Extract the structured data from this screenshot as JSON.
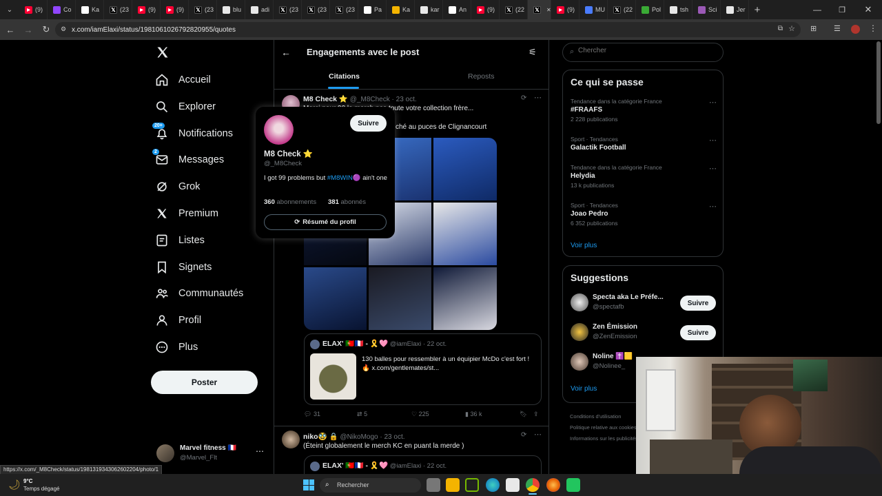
{
  "browser": {
    "tabs": [
      {
        "label": "(9)",
        "color": "#ff0033",
        "icon": "youtube-icon"
      },
      {
        "label": "Co",
        "color": "#9146ff",
        "icon": "twitch-icon"
      },
      {
        "label": "Ka",
        "color": "#ffffff",
        "icon": "kick-icon"
      },
      {
        "label": "(23",
        "color": "#000000",
        "icon": "x-icon"
      },
      {
        "label": "(9)",
        "color": "#ff0033",
        "icon": "youtube-icon"
      },
      {
        "label": "(9)",
        "color": "#ff0033",
        "icon": "youtube-icon"
      },
      {
        "label": "(23",
        "color": "#000000",
        "icon": "x-icon"
      },
      {
        "label": "blu",
        "color": "#e8e8e8",
        "icon": "globe-icon"
      },
      {
        "label": "adi",
        "color": "#e8e8e8",
        "icon": "globe-icon"
      },
      {
        "label": "(23",
        "color": "#000000",
        "icon": "x-icon"
      },
      {
        "label": "(23",
        "color": "#000000",
        "icon": "x-icon"
      },
      {
        "label": "(23",
        "color": "#000000",
        "icon": "x-icon"
      },
      {
        "label": "Pa",
        "color": "#ffffff",
        "icon": "page-icon"
      },
      {
        "label": "Ka",
        "color": "#f4b400",
        "icon": "folder-icon"
      },
      {
        "label": "kar",
        "color": "#e8e8e8",
        "icon": "globe-icon"
      },
      {
        "label": "An",
        "color": "#ffffff",
        "icon": "wikipedia-icon"
      },
      {
        "label": "(9)",
        "color": "#ff0033",
        "icon": "youtube-icon"
      },
      {
        "label": "(22",
        "color": "#000000",
        "icon": "x-icon"
      },
      {
        "label": "",
        "color": "#000000",
        "icon": "x-icon",
        "active": true
      },
      {
        "label": "(9)",
        "color": "#ff0033",
        "icon": "youtube-icon"
      },
      {
        "label": "MU",
        "color": "#4a7cff",
        "icon": "page-icon"
      },
      {
        "label": "(22",
        "color": "#000000",
        "icon": "x-icon"
      },
      {
        "label": "Pol",
        "color": "#3aaa35",
        "icon": "page-icon"
      },
      {
        "label": "tsh",
        "color": "#e8e8e8",
        "icon": "globe-icon"
      },
      {
        "label": "Sci",
        "color": "#9b59b6",
        "icon": "page-icon"
      },
      {
        "label": "Jer",
        "color": "#e8e8e8",
        "icon": "page-icon"
      }
    ],
    "url": "x.com/iamElaxi/status/1981061026792820955/quotes",
    "status_url": "https://x.com/_M8Check/status/1981319343062602204/photo/1"
  },
  "nav": {
    "items": [
      {
        "label": "Accueil",
        "icon": "home-icon"
      },
      {
        "label": "Explorer",
        "icon": "search-icon"
      },
      {
        "label": "Notifications",
        "icon": "bell-icon",
        "badge": "20+"
      },
      {
        "label": "Messages",
        "icon": "mail-icon",
        "badge": "2"
      },
      {
        "label": "Grok",
        "icon": "grok-icon"
      },
      {
        "label": "Premium",
        "icon": "x-logo-icon"
      },
      {
        "label": "Listes",
        "icon": "list-icon"
      },
      {
        "label": "Signets",
        "icon": "bookmark-icon"
      },
      {
        "label": "Communautés",
        "icon": "people-icon"
      },
      {
        "label": "Profil",
        "icon": "person-icon"
      },
      {
        "label": "Plus",
        "icon": "more-circle-icon"
      }
    ],
    "post_label": "Poster",
    "account": {
      "name": "Marvel fitness 🇫🇷",
      "handle": "@Marvel_Flt"
    }
  },
  "header": {
    "title": "Engagements avec le post",
    "tabs": [
      "Citations",
      "Reposts"
    ],
    "active_tab": 0
  },
  "tweet1": {
    "name": "M8 Check ⭐",
    "handle": "@_M8Check",
    "date": "· 23 oct.",
    "text_line1": "Merci pour 90 le merch pas toute votre collection frère...",
    "text_line2": "ché au puces de Clignancourt",
    "quoted": {
      "name": "ELAX' 🇵🇹🇫🇷 - 🎗️🩷",
      "handle": "@iamElaxi",
      "date": "· 22 oct.",
      "text": "130 balles pour ressembler à un équipier McDo c'est fort ! 🔥 x.com/gentlemates/st..."
    },
    "stats": {
      "replies": "31",
      "reposts": "5",
      "likes": "225",
      "views": "36 k"
    }
  },
  "tweet2": {
    "name": "niko🥸 🔒",
    "handle": "@NikoMogo",
    "date": "· 23 oct.",
    "text": "(Éteint globalement le merch KC en puant la merde )",
    "quoted": {
      "name": "ELAX' 🇵🇹🇫🇷 - 🎗️🩷",
      "handle": "@iamElaxi",
      "date": "· 22 oct."
    }
  },
  "hovercard": {
    "name": "M8 Check ⭐",
    "handle": "@_M8Check",
    "follow_label": "Suivre",
    "bio_pre": "I got 99 problems but ",
    "bio_tag": "#M8WIN",
    "bio_post": "🟣 ain't one",
    "following_count": "360",
    "following_label": "abonnements",
    "followers_count": "381",
    "followers_label": "abonnés",
    "summary_label": "Résumé du profil"
  },
  "search": {
    "placeholder": "Chercher"
  },
  "trends": {
    "title": "Ce qui se passe",
    "items": [
      {
        "meta": "Tendance dans la catégorie France",
        "name": "#FRAAFS",
        "count": "2 228 publications"
      },
      {
        "meta": "Sport · Tendances",
        "name": "Galactik Football",
        "count": ""
      },
      {
        "meta": "Tendance dans la catégorie France",
        "name": "Helydia",
        "count": "13 k publications"
      },
      {
        "meta": "Sport · Tendances",
        "name": "Joao Pedro",
        "count": "6 352 publications"
      }
    ],
    "more": "Voir plus"
  },
  "suggestions": {
    "title": "Suggestions",
    "items": [
      {
        "name": "Specta aka Le Préfe...",
        "handle": "@spectafb",
        "follow": "Suivre"
      },
      {
        "name": "Zen Émission",
        "handle": "@ZenEmission",
        "follow": "Suivre"
      },
      {
        "name": "Noline ✝️🟨",
        "handle": "@Nolinee_",
        "follow": ""
      }
    ],
    "more": "Voir plus"
  },
  "footer": {
    "terms": "Conditions d'utilisation",
    "privacy": "Politique relative aux cookies",
    "ads": "Informations sur les publicités"
  },
  "taskbar": {
    "temp": "9°C",
    "weather": "Temps dégagé",
    "search_placeholder": "Rechercher"
  }
}
